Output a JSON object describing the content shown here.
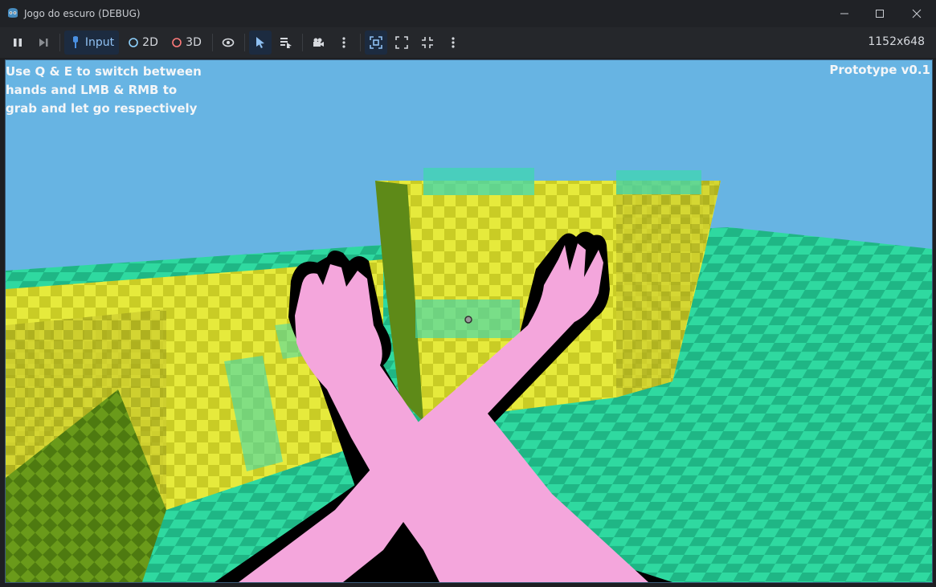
{
  "window": {
    "title": "Jogo do escuro (DEBUG)",
    "controls": [
      "minimize-icon",
      "maximize-icon",
      "close-icon"
    ]
  },
  "toolbar": {
    "pause_icon": "pause-icon",
    "step_icon": "next-frame-icon",
    "input_label": "Input",
    "mode_2d_label": "2D",
    "mode_3d_label": "3D",
    "resolution": "1152x648",
    "colors": {
      "accent": "#4a90e2",
      "mode2d": "#8fd3ff",
      "mode3d": "#ff7a7a"
    }
  },
  "game": {
    "help_text": "Use Q & E to switch between hands and LMB & RMB to grab and let go respectively",
    "version": "Prototype v0.1",
    "colors": {
      "sky": "#67b4e3",
      "floor": "#2fd9a0",
      "blocks": "#e8ec3a",
      "hands": "#f4a6dc"
    }
  }
}
